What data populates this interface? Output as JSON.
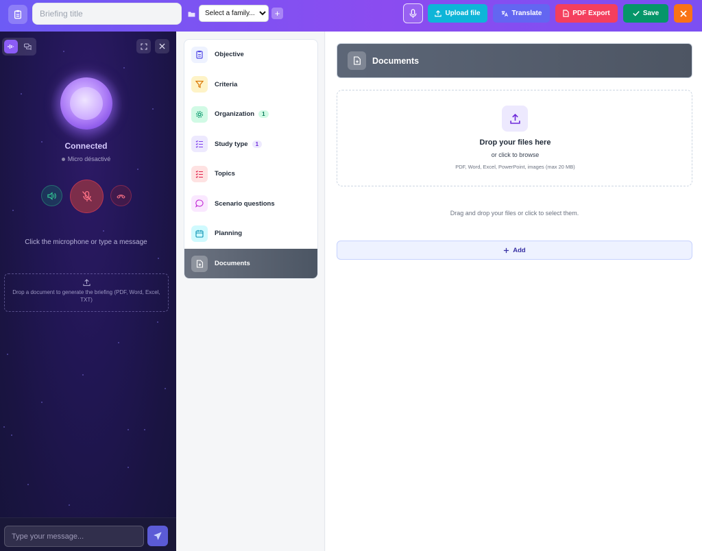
{
  "header": {
    "title_placeholder": "Briefing title",
    "family_select": {
      "selected": "Select a family...",
      "options": [
        "Select a family..."
      ]
    },
    "add_family": "+",
    "upload_label": "Upload file",
    "translate_label": "Translate",
    "pdf_label": "PDF Export",
    "save_label": "Save",
    "colors": {
      "bar": "#7c4ff2",
      "upload": "#0eb5d8",
      "translate": "#6366f1",
      "pdf": "#f43f5e",
      "save": "#059669",
      "close": "#f97316"
    }
  },
  "voice": {
    "status": "Connected",
    "sub_status": "Micro désactivé",
    "hint": "Click the microphone or type a message",
    "dropzone_text": "Drop a document to generate the briefing (PDF, Word, Excel, TXT)",
    "chat_placeholder": "Type your message..."
  },
  "nav": {
    "items": [
      {
        "label": "Objective",
        "icon": "clipboard-icon",
        "badge": ""
      },
      {
        "label": "Criteria",
        "icon": "filter-icon",
        "badge": ""
      },
      {
        "label": "Organization",
        "icon": "gear-icon",
        "badge": "1"
      },
      {
        "label": "Study type",
        "icon": "checklist-icon",
        "badge": "1"
      },
      {
        "label": "Topics",
        "icon": "list-icon",
        "badge": ""
      },
      {
        "label": "Scenario questions",
        "icon": "chat-bubble-icon",
        "badge": ""
      },
      {
        "label": "Planning",
        "icon": "calendar-icon",
        "badge": ""
      },
      {
        "label": "Documents",
        "icon": "file-icon",
        "badge": ""
      }
    ],
    "active": "Documents"
  },
  "main": {
    "section_title": "Documents",
    "drop_title": "Drop your files here",
    "drop_sub": "or click to browse",
    "drop_hint": "PDF, Word, Excel, PowerPoint, images (max 20 MB)",
    "empty_message": "Drag and drop your files or click to select them.",
    "add_label": "Add"
  }
}
